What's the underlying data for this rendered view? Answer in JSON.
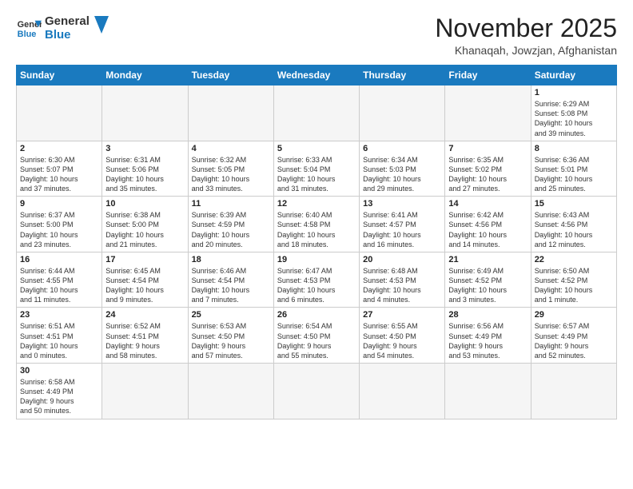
{
  "header": {
    "logo_general": "General",
    "logo_blue": "Blue",
    "month_title": "November 2025",
    "location": "Khanaqah, Jowzjan, Afghanistan"
  },
  "weekdays": [
    "Sunday",
    "Monday",
    "Tuesday",
    "Wednesday",
    "Thursday",
    "Friday",
    "Saturday"
  ],
  "weeks": [
    [
      {
        "day": "",
        "info": ""
      },
      {
        "day": "",
        "info": ""
      },
      {
        "day": "",
        "info": ""
      },
      {
        "day": "",
        "info": ""
      },
      {
        "day": "",
        "info": ""
      },
      {
        "day": "",
        "info": ""
      },
      {
        "day": "1",
        "info": "Sunrise: 6:29 AM\nSunset: 5:08 PM\nDaylight: 10 hours\nand 39 minutes."
      }
    ],
    [
      {
        "day": "2",
        "info": "Sunrise: 6:30 AM\nSunset: 5:07 PM\nDaylight: 10 hours\nand 37 minutes."
      },
      {
        "day": "3",
        "info": "Sunrise: 6:31 AM\nSunset: 5:06 PM\nDaylight: 10 hours\nand 35 minutes."
      },
      {
        "day": "4",
        "info": "Sunrise: 6:32 AM\nSunset: 5:05 PM\nDaylight: 10 hours\nand 33 minutes."
      },
      {
        "day": "5",
        "info": "Sunrise: 6:33 AM\nSunset: 5:04 PM\nDaylight: 10 hours\nand 31 minutes."
      },
      {
        "day": "6",
        "info": "Sunrise: 6:34 AM\nSunset: 5:03 PM\nDaylight: 10 hours\nand 29 minutes."
      },
      {
        "day": "7",
        "info": "Sunrise: 6:35 AM\nSunset: 5:02 PM\nDaylight: 10 hours\nand 27 minutes."
      },
      {
        "day": "8",
        "info": "Sunrise: 6:36 AM\nSunset: 5:01 PM\nDaylight: 10 hours\nand 25 minutes."
      }
    ],
    [
      {
        "day": "9",
        "info": "Sunrise: 6:37 AM\nSunset: 5:00 PM\nDaylight: 10 hours\nand 23 minutes."
      },
      {
        "day": "10",
        "info": "Sunrise: 6:38 AM\nSunset: 5:00 PM\nDaylight: 10 hours\nand 21 minutes."
      },
      {
        "day": "11",
        "info": "Sunrise: 6:39 AM\nSunset: 4:59 PM\nDaylight: 10 hours\nand 20 minutes."
      },
      {
        "day": "12",
        "info": "Sunrise: 6:40 AM\nSunset: 4:58 PM\nDaylight: 10 hours\nand 18 minutes."
      },
      {
        "day": "13",
        "info": "Sunrise: 6:41 AM\nSunset: 4:57 PM\nDaylight: 10 hours\nand 16 minutes."
      },
      {
        "day": "14",
        "info": "Sunrise: 6:42 AM\nSunset: 4:56 PM\nDaylight: 10 hours\nand 14 minutes."
      },
      {
        "day": "15",
        "info": "Sunrise: 6:43 AM\nSunset: 4:56 PM\nDaylight: 10 hours\nand 12 minutes."
      }
    ],
    [
      {
        "day": "16",
        "info": "Sunrise: 6:44 AM\nSunset: 4:55 PM\nDaylight: 10 hours\nand 11 minutes."
      },
      {
        "day": "17",
        "info": "Sunrise: 6:45 AM\nSunset: 4:54 PM\nDaylight: 10 hours\nand 9 minutes."
      },
      {
        "day": "18",
        "info": "Sunrise: 6:46 AM\nSunset: 4:54 PM\nDaylight: 10 hours\nand 7 minutes."
      },
      {
        "day": "19",
        "info": "Sunrise: 6:47 AM\nSunset: 4:53 PM\nDaylight: 10 hours\nand 6 minutes."
      },
      {
        "day": "20",
        "info": "Sunrise: 6:48 AM\nSunset: 4:53 PM\nDaylight: 10 hours\nand 4 minutes."
      },
      {
        "day": "21",
        "info": "Sunrise: 6:49 AM\nSunset: 4:52 PM\nDaylight: 10 hours\nand 3 minutes."
      },
      {
        "day": "22",
        "info": "Sunrise: 6:50 AM\nSunset: 4:52 PM\nDaylight: 10 hours\nand 1 minute."
      }
    ],
    [
      {
        "day": "23",
        "info": "Sunrise: 6:51 AM\nSunset: 4:51 PM\nDaylight: 10 hours\nand 0 minutes."
      },
      {
        "day": "24",
        "info": "Sunrise: 6:52 AM\nSunset: 4:51 PM\nDaylight: 9 hours\nand 58 minutes."
      },
      {
        "day": "25",
        "info": "Sunrise: 6:53 AM\nSunset: 4:50 PM\nDaylight: 9 hours\nand 57 minutes."
      },
      {
        "day": "26",
        "info": "Sunrise: 6:54 AM\nSunset: 4:50 PM\nDaylight: 9 hours\nand 55 minutes."
      },
      {
        "day": "27",
        "info": "Sunrise: 6:55 AM\nSunset: 4:50 PM\nDaylight: 9 hours\nand 54 minutes."
      },
      {
        "day": "28",
        "info": "Sunrise: 6:56 AM\nSunset: 4:49 PM\nDaylight: 9 hours\nand 53 minutes."
      },
      {
        "day": "29",
        "info": "Sunrise: 6:57 AM\nSunset: 4:49 PM\nDaylight: 9 hours\nand 52 minutes."
      }
    ],
    [
      {
        "day": "30",
        "info": "Sunrise: 6:58 AM\nSunset: 4:49 PM\nDaylight: 9 hours\nand 50 minutes."
      },
      {
        "day": "",
        "info": ""
      },
      {
        "day": "",
        "info": ""
      },
      {
        "day": "",
        "info": ""
      },
      {
        "day": "",
        "info": ""
      },
      {
        "day": "",
        "info": ""
      },
      {
        "day": "",
        "info": ""
      }
    ]
  ]
}
